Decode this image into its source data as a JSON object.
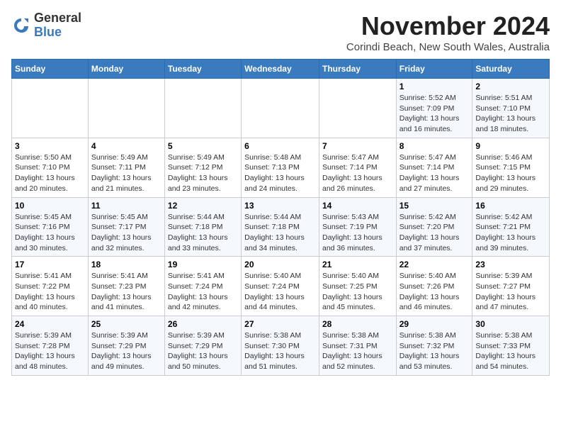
{
  "header": {
    "logo_general": "General",
    "logo_blue": "Blue",
    "month": "November 2024",
    "location": "Corindi Beach, New South Wales, Australia"
  },
  "weekdays": [
    "Sunday",
    "Monday",
    "Tuesday",
    "Wednesday",
    "Thursday",
    "Friday",
    "Saturday"
  ],
  "weeks": [
    [
      {
        "day": "",
        "detail": ""
      },
      {
        "day": "",
        "detail": ""
      },
      {
        "day": "",
        "detail": ""
      },
      {
        "day": "",
        "detail": ""
      },
      {
        "day": "",
        "detail": ""
      },
      {
        "day": "1",
        "detail": "Sunrise: 5:52 AM\nSunset: 7:09 PM\nDaylight: 13 hours and 16 minutes."
      },
      {
        "day": "2",
        "detail": "Sunrise: 5:51 AM\nSunset: 7:10 PM\nDaylight: 13 hours and 18 minutes."
      }
    ],
    [
      {
        "day": "3",
        "detail": "Sunrise: 5:50 AM\nSunset: 7:10 PM\nDaylight: 13 hours and 20 minutes."
      },
      {
        "day": "4",
        "detail": "Sunrise: 5:49 AM\nSunset: 7:11 PM\nDaylight: 13 hours and 21 minutes."
      },
      {
        "day": "5",
        "detail": "Sunrise: 5:49 AM\nSunset: 7:12 PM\nDaylight: 13 hours and 23 minutes."
      },
      {
        "day": "6",
        "detail": "Sunrise: 5:48 AM\nSunset: 7:13 PM\nDaylight: 13 hours and 24 minutes."
      },
      {
        "day": "7",
        "detail": "Sunrise: 5:47 AM\nSunset: 7:14 PM\nDaylight: 13 hours and 26 minutes."
      },
      {
        "day": "8",
        "detail": "Sunrise: 5:47 AM\nSunset: 7:14 PM\nDaylight: 13 hours and 27 minutes."
      },
      {
        "day": "9",
        "detail": "Sunrise: 5:46 AM\nSunset: 7:15 PM\nDaylight: 13 hours and 29 minutes."
      }
    ],
    [
      {
        "day": "10",
        "detail": "Sunrise: 5:45 AM\nSunset: 7:16 PM\nDaylight: 13 hours and 30 minutes."
      },
      {
        "day": "11",
        "detail": "Sunrise: 5:45 AM\nSunset: 7:17 PM\nDaylight: 13 hours and 32 minutes."
      },
      {
        "day": "12",
        "detail": "Sunrise: 5:44 AM\nSunset: 7:18 PM\nDaylight: 13 hours and 33 minutes."
      },
      {
        "day": "13",
        "detail": "Sunrise: 5:44 AM\nSunset: 7:18 PM\nDaylight: 13 hours and 34 minutes."
      },
      {
        "day": "14",
        "detail": "Sunrise: 5:43 AM\nSunset: 7:19 PM\nDaylight: 13 hours and 36 minutes."
      },
      {
        "day": "15",
        "detail": "Sunrise: 5:42 AM\nSunset: 7:20 PM\nDaylight: 13 hours and 37 minutes."
      },
      {
        "day": "16",
        "detail": "Sunrise: 5:42 AM\nSunset: 7:21 PM\nDaylight: 13 hours and 39 minutes."
      }
    ],
    [
      {
        "day": "17",
        "detail": "Sunrise: 5:41 AM\nSunset: 7:22 PM\nDaylight: 13 hours and 40 minutes."
      },
      {
        "day": "18",
        "detail": "Sunrise: 5:41 AM\nSunset: 7:23 PM\nDaylight: 13 hours and 41 minutes."
      },
      {
        "day": "19",
        "detail": "Sunrise: 5:41 AM\nSunset: 7:24 PM\nDaylight: 13 hours and 42 minutes."
      },
      {
        "day": "20",
        "detail": "Sunrise: 5:40 AM\nSunset: 7:24 PM\nDaylight: 13 hours and 44 minutes."
      },
      {
        "day": "21",
        "detail": "Sunrise: 5:40 AM\nSunset: 7:25 PM\nDaylight: 13 hours and 45 minutes."
      },
      {
        "day": "22",
        "detail": "Sunrise: 5:40 AM\nSunset: 7:26 PM\nDaylight: 13 hours and 46 minutes."
      },
      {
        "day": "23",
        "detail": "Sunrise: 5:39 AM\nSunset: 7:27 PM\nDaylight: 13 hours and 47 minutes."
      }
    ],
    [
      {
        "day": "24",
        "detail": "Sunrise: 5:39 AM\nSunset: 7:28 PM\nDaylight: 13 hours and 48 minutes."
      },
      {
        "day": "25",
        "detail": "Sunrise: 5:39 AM\nSunset: 7:29 PM\nDaylight: 13 hours and 49 minutes."
      },
      {
        "day": "26",
        "detail": "Sunrise: 5:39 AM\nSunset: 7:29 PM\nDaylight: 13 hours and 50 minutes."
      },
      {
        "day": "27",
        "detail": "Sunrise: 5:38 AM\nSunset: 7:30 PM\nDaylight: 13 hours and 51 minutes."
      },
      {
        "day": "28",
        "detail": "Sunrise: 5:38 AM\nSunset: 7:31 PM\nDaylight: 13 hours and 52 minutes."
      },
      {
        "day": "29",
        "detail": "Sunrise: 5:38 AM\nSunset: 7:32 PM\nDaylight: 13 hours and 53 minutes."
      },
      {
        "day": "30",
        "detail": "Sunrise: 5:38 AM\nSunset: 7:33 PM\nDaylight: 13 hours and 54 minutes."
      }
    ]
  ]
}
